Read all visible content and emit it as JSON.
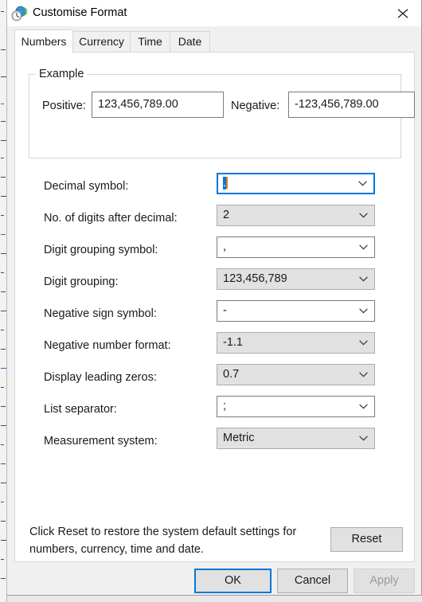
{
  "window": {
    "title": "Customise Format",
    "icon": "globe-clock-icon",
    "close_label": "✕"
  },
  "tabs": [
    {
      "label": "Numbers",
      "selected": true
    },
    {
      "label": "Currency",
      "selected": false
    },
    {
      "label": "Time",
      "selected": false
    },
    {
      "label": "Date",
      "selected": false
    }
  ],
  "example": {
    "legend": "Example",
    "positive_label": "Positive:",
    "positive_value": "123,456,789.00",
    "negative_label": "Negative:",
    "negative_value": "-123,456,789.00"
  },
  "settings": [
    {
      "label": "Decimal symbol:",
      "value": ".",
      "style": "focused",
      "selected": true
    },
    {
      "label": "No. of digits after decimal:",
      "value": "2",
      "style": "gray",
      "selected": false
    },
    {
      "label": "Digit grouping symbol:",
      "value": ",",
      "style": "white",
      "selected": false
    },
    {
      "label": "Digit grouping:",
      "value": "123,456,789",
      "style": "gray",
      "selected": false
    },
    {
      "label": "Negative sign symbol:",
      "value": "-",
      "style": "white",
      "selected": false
    },
    {
      "label": "Negative number format:",
      "value": "-1.1",
      "style": "gray",
      "selected": false
    },
    {
      "label": "Display leading zeros:",
      "value": "0.7",
      "style": "gray",
      "selected": false
    },
    {
      "label": "List separator:",
      "value": ";",
      "style": "white",
      "selected": false
    },
    {
      "label": "Measurement system:",
      "value": "Metric",
      "style": "gray",
      "selected": false
    }
  ],
  "reset": {
    "description": "Click Reset to restore the system default settings for numbers, currency, time and date.",
    "button_label": "Reset"
  },
  "buttons": {
    "ok": "OK",
    "cancel": "Cancel",
    "apply": "Apply"
  },
  "colors": {
    "accent": "#0078d7",
    "dialog_bg": "#f0f0f0",
    "page_bg": "#ffffff",
    "control_gray": "#e1e1e1",
    "text": "#1a1a1a",
    "disabled_text": "#9a9a9a",
    "caret": "#e08020"
  }
}
